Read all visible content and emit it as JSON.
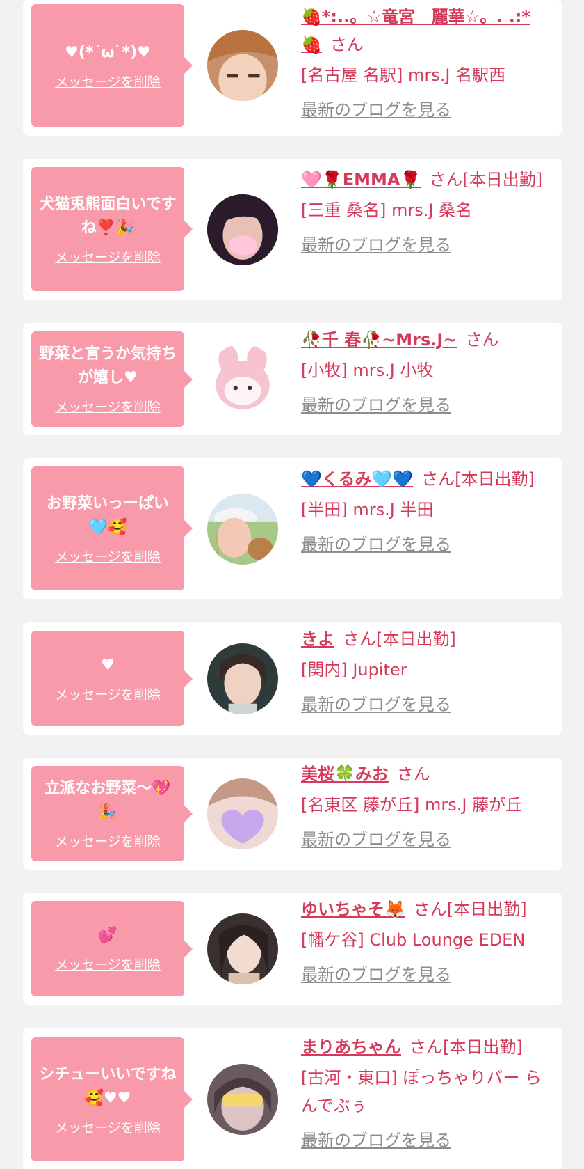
{
  "theme": {
    "accent": "#d63a5b",
    "bubble": "#f89aaa",
    "muted": "#8c8c8c",
    "background": "#f2f2f2"
  },
  "entries": [
    {
      "message": "♥(*´ω`*)♥",
      "delete_label": "メッセージを削除",
      "name": "🍓*:..。☆竜宮　麗華☆。. .:*🍓",
      "honorific": "さん",
      "status": "",
      "shop": "[名古屋 名駅] mrs.J 名駅西",
      "blog_label": "最新のブログを見る",
      "avatar": "avatar-photo-1"
    },
    {
      "message": "犬猫兎熊面白いですね❣️🎉",
      "delete_label": "メッセージを削除",
      "name": "🩷🌹EMMA🌹",
      "honorific": "さん",
      "status": "[本日出勤]",
      "shop": "[三重 桑名] mrs.J 桑名",
      "blog_label": "最新のブログを見る",
      "avatar": "avatar-photo-2"
    },
    {
      "message": "野菜と言うか気持ちが嬉し♥",
      "delete_label": "メッセージを削除",
      "name": "🥀千 春🥀~Mrs.J~",
      "honorific": "さん",
      "status": "",
      "shop": "[小牧] mrs.J 小牧",
      "blog_label": "最新のブログを見る",
      "avatar": "avatar-plush-toy"
    },
    {
      "message": "お野菜いっーぱい🩵🥰",
      "delete_label": "メッセージを削除",
      "name": "💙くるみ🩵💙",
      "honorific": "さん",
      "status": "[本日出勤]",
      "shop": "[半田] mrs.J 半田",
      "blog_label": "最新のブログを見る",
      "avatar": "avatar-photo-4"
    },
    {
      "message": "♥",
      "delete_label": "メッセージを削除",
      "name": "きよ",
      "honorific": "さん",
      "status": "[本日出勤]",
      "shop": "[関内] Jupiter",
      "blog_label": "最新のブログを見る",
      "avatar": "avatar-photo-5"
    },
    {
      "message": "立派なお野菜〜💖🎉",
      "delete_label": "メッセージを削除",
      "name": "美桜🍀みお",
      "honorific": "さん",
      "status": "",
      "shop": "[名東区 藤が丘] mrs.J 藤が丘",
      "blog_label": "最新のブログを見る",
      "avatar": "avatar-photo-6"
    },
    {
      "message": "💕",
      "delete_label": "メッセージを削除",
      "name": "ゆいちゃそ🦊",
      "honorific": "さん",
      "status": "[本日出勤]",
      "shop": "[幡ケ谷] Club Lounge EDEN",
      "blog_label": "最新のブログを見る",
      "avatar": "avatar-photo-7"
    },
    {
      "message": "シチューいいですね🥰♥♥",
      "delete_label": "メッセージを削除",
      "name": "まりあちゃん",
      "honorific": "さん",
      "status": "[本日出勤]",
      "shop": "[古河・東口] ぽっちゃりバー らんでぶぅ",
      "blog_label": "最新のブログを見る",
      "avatar": "avatar-photo-8"
    }
  ]
}
